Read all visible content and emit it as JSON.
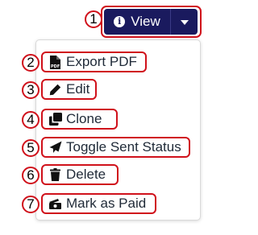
{
  "button": {
    "view_label": "View",
    "icon": "info-circle-icon",
    "toggle_icon": "caret-down-icon",
    "color": "#1a1a5e"
  },
  "annotation_color": "#d0111b",
  "badges": [
    "1",
    "2",
    "3",
    "4",
    "5",
    "6",
    "7"
  ],
  "menu": {
    "items": [
      {
        "label": "Export PDF",
        "icon": "file-pdf-icon"
      },
      {
        "label": "Edit",
        "icon": "pencil-icon"
      },
      {
        "label": "Clone",
        "icon": "clone-icon"
      },
      {
        "label": "Toggle Sent Status",
        "icon": "paper-plane-icon"
      },
      {
        "label": "Delete",
        "icon": "trash-icon"
      },
      {
        "label": "Mark as Paid",
        "icon": "money-check-icon"
      }
    ]
  }
}
